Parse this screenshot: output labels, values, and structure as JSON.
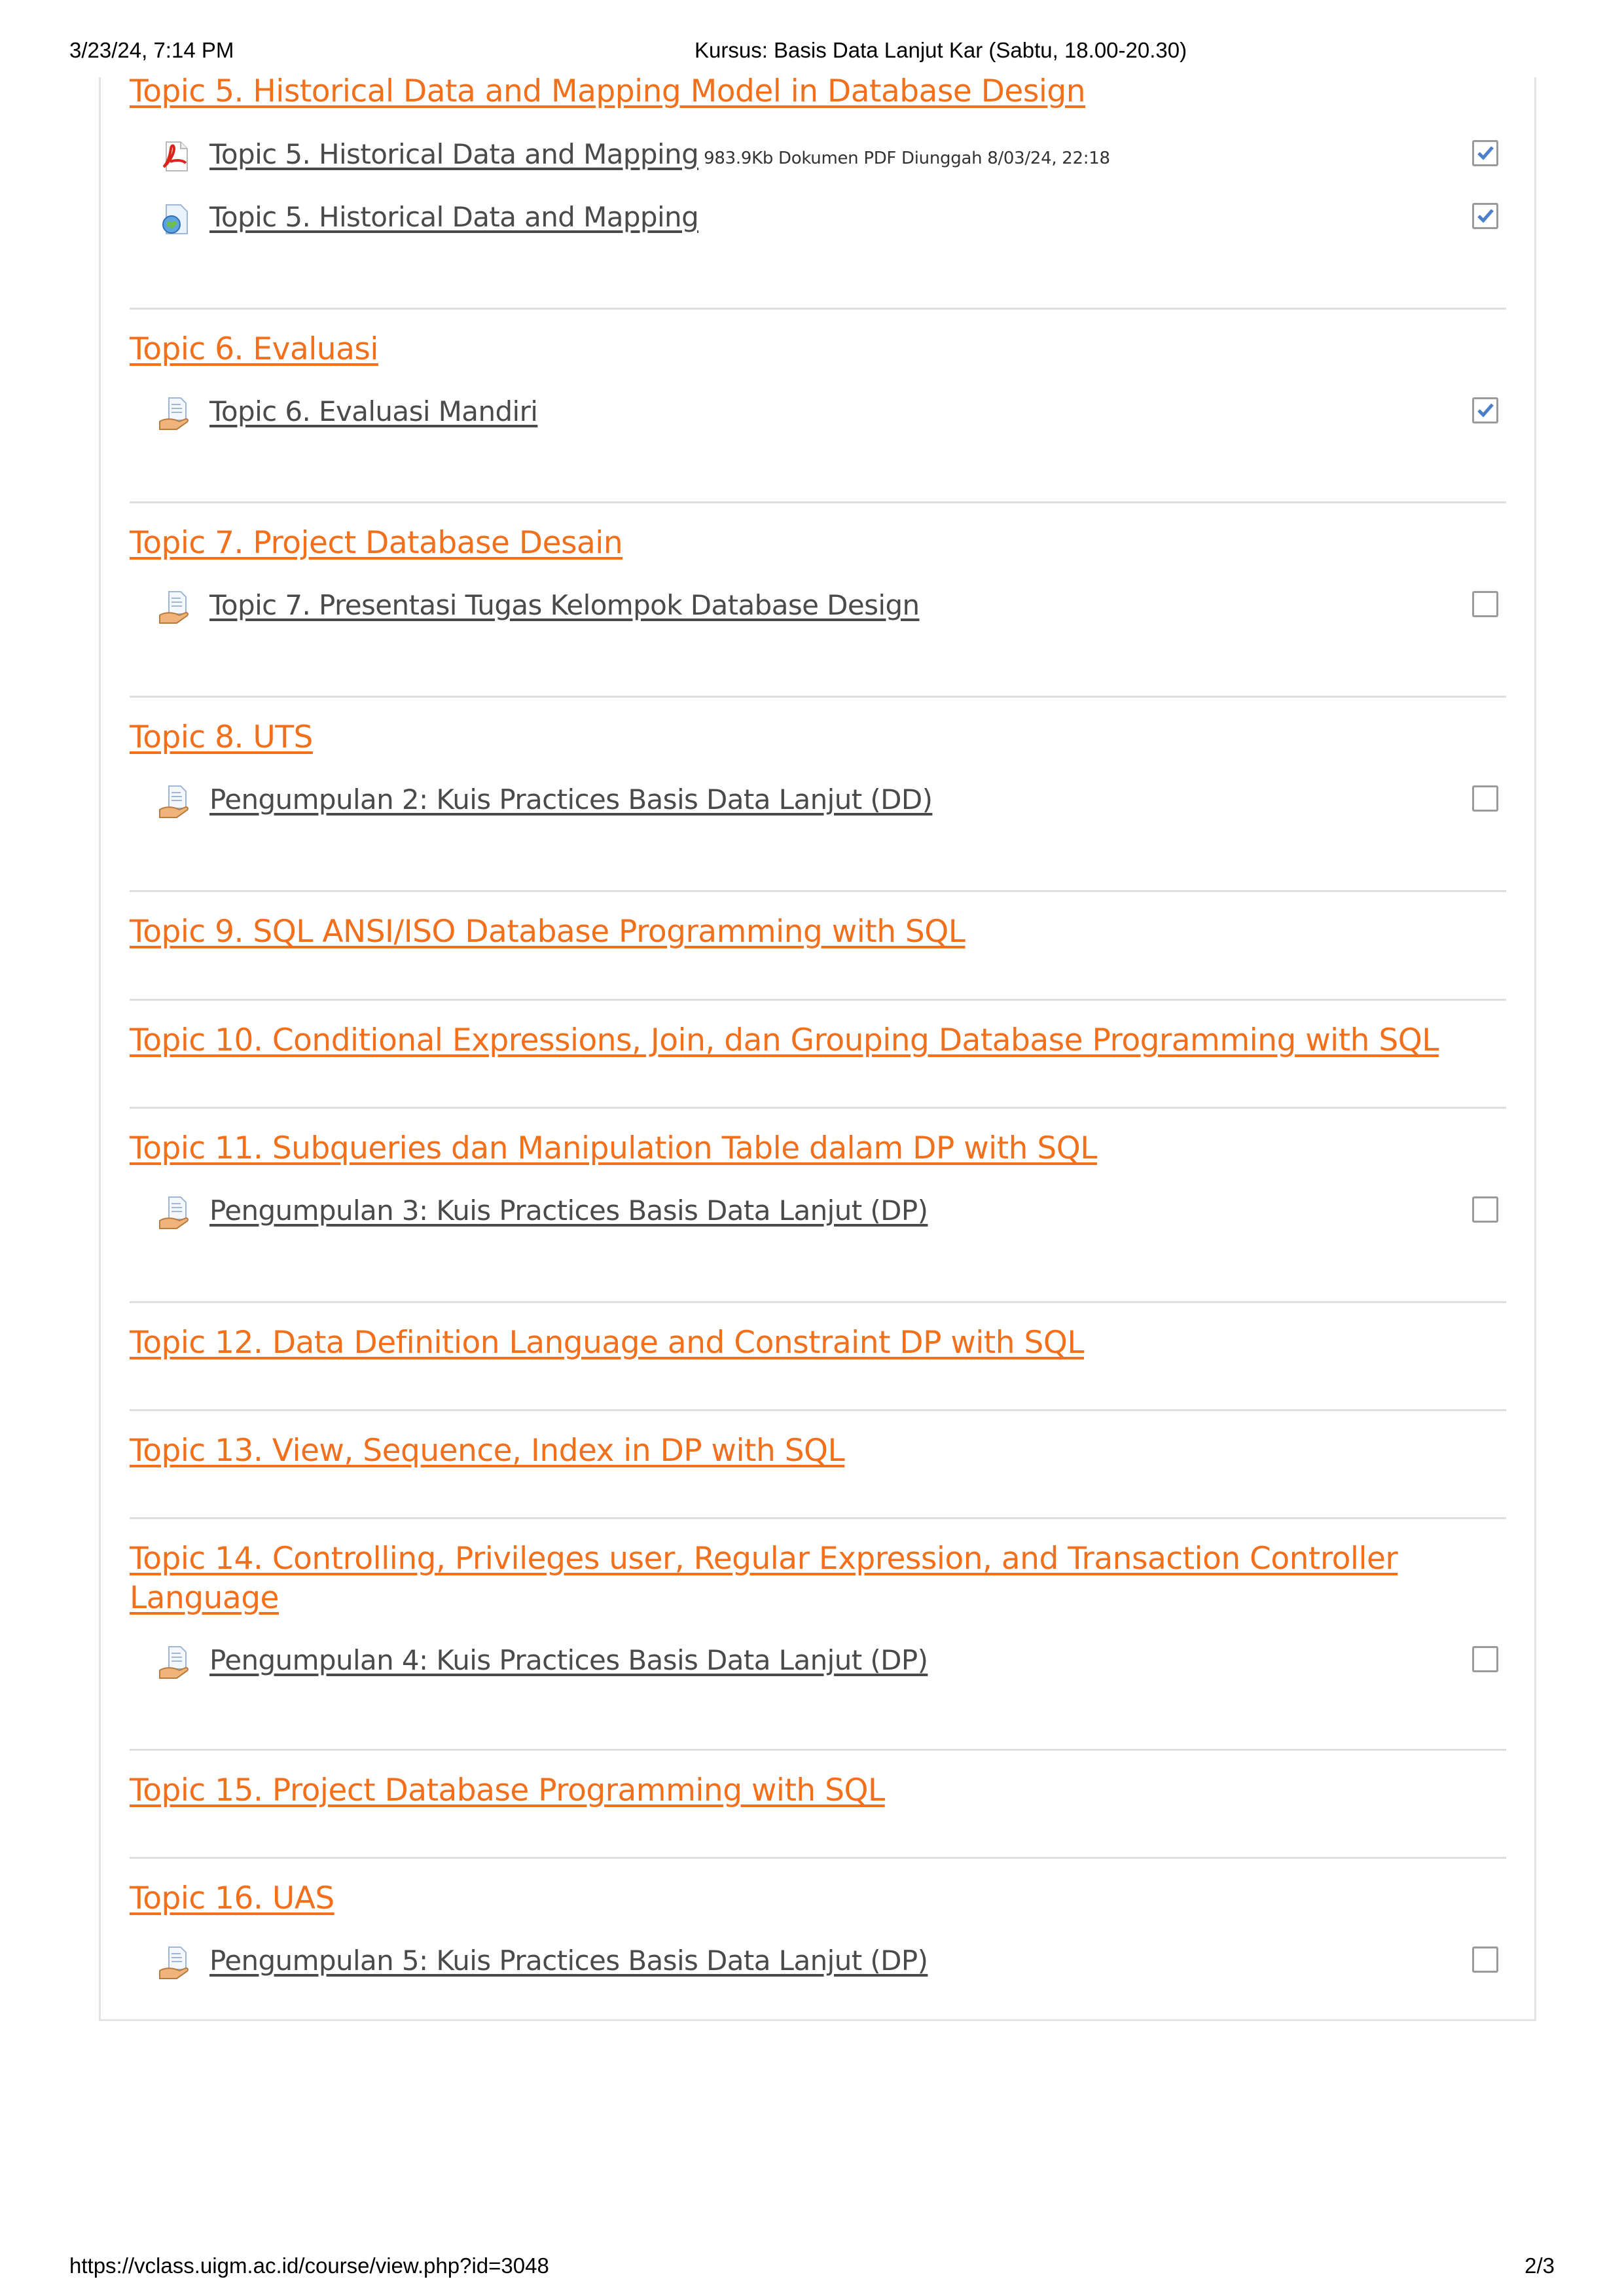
{
  "print_header": {
    "datetime": "3/23/24, 7:14 PM",
    "title": "Kursus: Basis Data Lanjut Kar (Sabtu, 18.00-20.30)"
  },
  "print_footer": {
    "url": "https://vclass.uigm.ac.id/course/view.php?id=3048",
    "page": "2/3"
  },
  "colors": {
    "link_orange": "#f26f1b",
    "activity_text": "#4a4a4a",
    "check_blue": "#4a7fc9",
    "divider": "#dedede"
  },
  "sections": [
    {
      "title": "Topic 5. Historical Data and Mapping Model in Database Design",
      "activities": [
        {
          "name": "Topic 5. Historical Data and Mapping",
          "meta": "983.9Kb Dokumen PDF Diunggah 8/03/24, 22:18",
          "icon": "pdf-icon",
          "completed": true
        },
        {
          "name": "Topic 5. Historical Data and Mapping",
          "icon": "url-globe-icon",
          "completed": true
        }
      ]
    },
    {
      "title": "Topic 6. Evaluasi",
      "activities": [
        {
          "name": "Topic 6. Evaluasi Mandiri",
          "icon": "assignment-icon",
          "completed": true
        }
      ]
    },
    {
      "title": "Topic 7. Project Database Desain",
      "activities": [
        {
          "name": "Topic 7. Presentasi Tugas Kelompok Database Design",
          "icon": "assignment-icon",
          "completed": false
        }
      ]
    },
    {
      "title": "Topic 8. UTS",
      "activities": [
        {
          "name": "Pengumpulan 2: Kuis Practices Basis Data Lanjut (DD)",
          "icon": "assignment-icon",
          "completed": false
        }
      ]
    },
    {
      "title": "Topic 9. SQL ANSI/ISO Database Programming with SQL",
      "activities": []
    },
    {
      "title": "Topic 10. Conditional Expressions, Join, dan Grouping Database Programming with SQL",
      "activities": []
    },
    {
      "title": "Topic 11. Subqueries dan Manipulation Table dalam DP with SQL",
      "activities": [
        {
          "name": "Pengumpulan 3: Kuis Practices Basis Data Lanjut (DP)",
          "icon": "assignment-icon",
          "completed": false
        }
      ]
    },
    {
      "title": "Topic 12. Data Definition Language and Constraint DP with SQL",
      "activities": []
    },
    {
      "title": "Topic 13. View, Sequence, Index in DP with SQL",
      "activities": []
    },
    {
      "title": "Topic 14. Controlling, Privileges user, Regular Expression, and Transaction Controller Language",
      "activities": [
        {
          "name": "Pengumpulan 4: Kuis Practices Basis Data Lanjut (DP)",
          "icon": "assignment-icon",
          "completed": false
        }
      ]
    },
    {
      "title": "Topic 15. Project Database Programming with SQL",
      "activities": []
    },
    {
      "title": "Topic 16. UAS",
      "activities": [
        {
          "name": "Pengumpulan 5: Kuis Practices Basis Data Lanjut (DP)",
          "icon": "assignment-icon",
          "completed": false
        }
      ]
    }
  ]
}
